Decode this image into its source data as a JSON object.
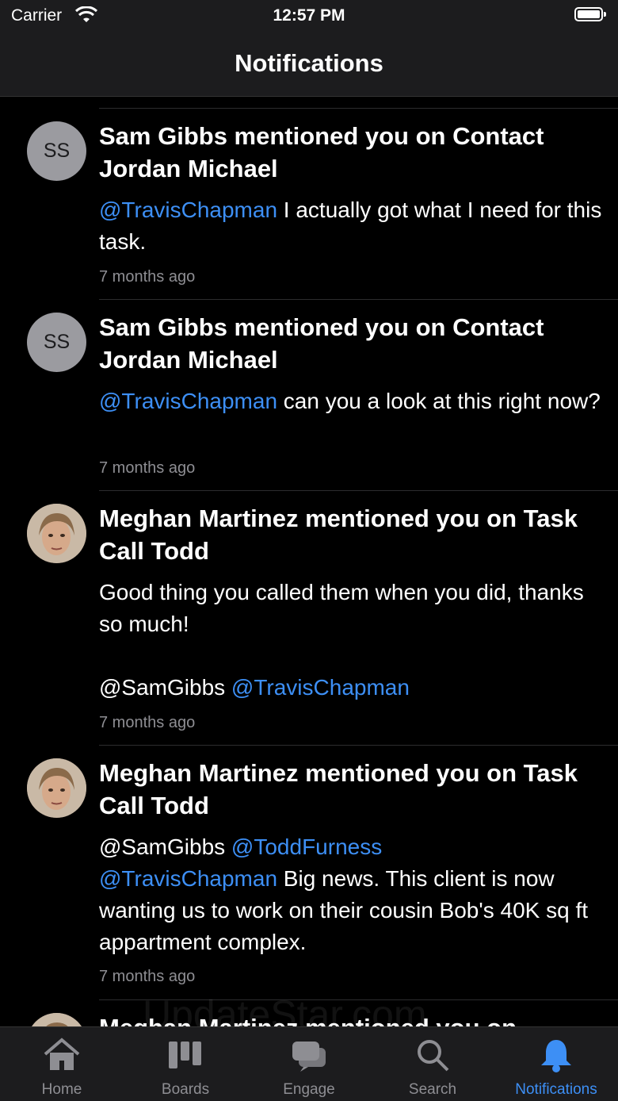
{
  "status_bar": {
    "carrier": "Carrier",
    "time": "12:57 PM"
  },
  "nav": {
    "title": "Notifications"
  },
  "notifications": [
    {
      "avatar_initials": "SS",
      "title": "Sam Gibbs mentioned you on Contact Jordan Michael",
      "body_parts": [
        {
          "text": "@TravisChapman",
          "mention": true
        },
        {
          "text": " I actually got what I need for this task.",
          "mention": false
        }
      ],
      "time": "7 months ago"
    },
    {
      "avatar_initials": "SS",
      "title": "Sam Gibbs mentioned you on Contact Jordan Michael",
      "body_parts": [
        {
          "text": "@TravisChapman",
          "mention": true
        },
        {
          "text": " can you a look at this right now?",
          "mention": false
        }
      ],
      "time": "7 months ago"
    },
    {
      "avatar_initials": "",
      "title": "Meghan Martinez mentioned you on Task Call Todd",
      "body_parts": [
        {
          "text": "Good thing you called them when you did, thanks so much!\n\n@SamGibbs ",
          "mention": false
        },
        {
          "text": "@TravisChapman",
          "mention": true
        }
      ],
      "time": "7 months ago"
    },
    {
      "avatar_initials": "",
      "title": "Meghan Martinez mentioned you on Task Call Todd",
      "body_parts": [
        {
          "text": "@SamGibbs ",
          "mention": false
        },
        {
          "text": "@ToddFurness",
          "mention": true
        },
        {
          "text": "\n",
          "mention": false
        },
        {
          "text": "@TravisChapman",
          "mention": true
        },
        {
          "text": " Big news. This client is now wanting us to work on their cousin Bob's 40K sq ft appartment complex.",
          "mention": false
        }
      ],
      "time": "7 months ago"
    },
    {
      "avatar_initials": "",
      "title": "Meghan Martinez mentioned you on",
      "body_parts": [],
      "time": ""
    }
  ],
  "tabs": [
    {
      "label": "Home",
      "icon": "house-icon"
    },
    {
      "label": "Boards",
      "icon": "boards-icon"
    },
    {
      "label": "Engage",
      "icon": "chat-bubbles-icon"
    },
    {
      "label": "Search",
      "icon": "magnifier-icon"
    },
    {
      "label": "Notifications",
      "icon": "bell-icon",
      "active": true
    }
  ],
  "colors": {
    "accent": "#3d8ff5",
    "background": "#000000",
    "bar": "#1c1c1e",
    "muted": "#8e8e93"
  },
  "watermark": "UpdateStar.com"
}
